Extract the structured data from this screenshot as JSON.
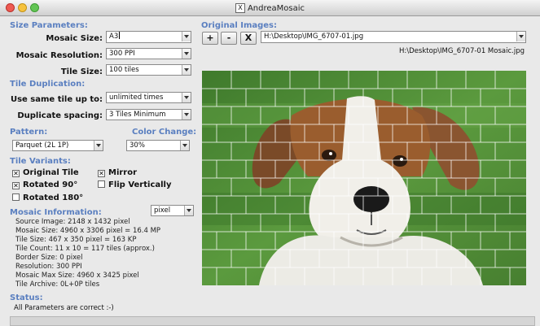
{
  "window": {
    "title": "AndreaMosaic"
  },
  "sections": {
    "size_parameters": "Size Parameters:",
    "tile_duplication": "Tile Duplication:",
    "pattern": "Pattern:",
    "color_change": "Color Change:",
    "tile_variants": "Tile Variants:",
    "mosaic_information": "Mosaic Information:",
    "original_images": "Original Images:",
    "status": "Status:"
  },
  "size_params": {
    "mosaic_size_label": "Mosaic Size:",
    "mosaic_size_value": "A3",
    "resolution_label": "Mosaic Resolution:",
    "resolution_value": "300 PPI",
    "tile_size_label": "Tile Size:",
    "tile_size_value": "100 tiles"
  },
  "tile_duplication": {
    "use_same_label": "Use same tile up to:",
    "use_same_value": "unlimited times",
    "dup_spacing_label": "Duplicate spacing:",
    "dup_spacing_value": "3 Tiles Minimum"
  },
  "pattern_value": "Parquet (2L 1P)",
  "color_change_value": "30%",
  "variants": {
    "original_tile": {
      "label": "Original Tile",
      "checked": true
    },
    "mirror": {
      "label": "Mirror",
      "checked": true
    },
    "rotated_90": {
      "label": "Rotated 90°",
      "checked": true
    },
    "flip_vertically": {
      "label": "Flip Vertically",
      "checked": false
    },
    "rotated_180": {
      "label": "Rotated 180°",
      "checked": false
    }
  },
  "info_unit": "pixel",
  "info_lines": [
    "Source Image: 2148 x 1432 pixel",
    "Mosaic Size: 4960 x 3306 pixel = 16.4 MP",
    "Tile Size: 467 x 350 pixel = 163 KP",
    "Tile Count: 11 x 10 = 117 tiles (approx.)",
    "Border Size: 0 pixel",
    "Resolution: 300 PPI",
    "Mosaic Max Size: 4960 x 3425 pixel",
    "Tile Archive: 0L+0P tiles"
  ],
  "original_images": {
    "add_label": "+",
    "remove_label": "-",
    "clear_label": "X",
    "path_value": "H:\\Desktop\\IMG_6707-01.jpg",
    "output_path": "H:\\Desktop\\IMG_6707-01 Mosaic.jpg"
  },
  "status_text": "All Parameters are correct :-)",
  "colors": {
    "section_header": "#5a7fc0",
    "grass": "#4f8a35"
  }
}
